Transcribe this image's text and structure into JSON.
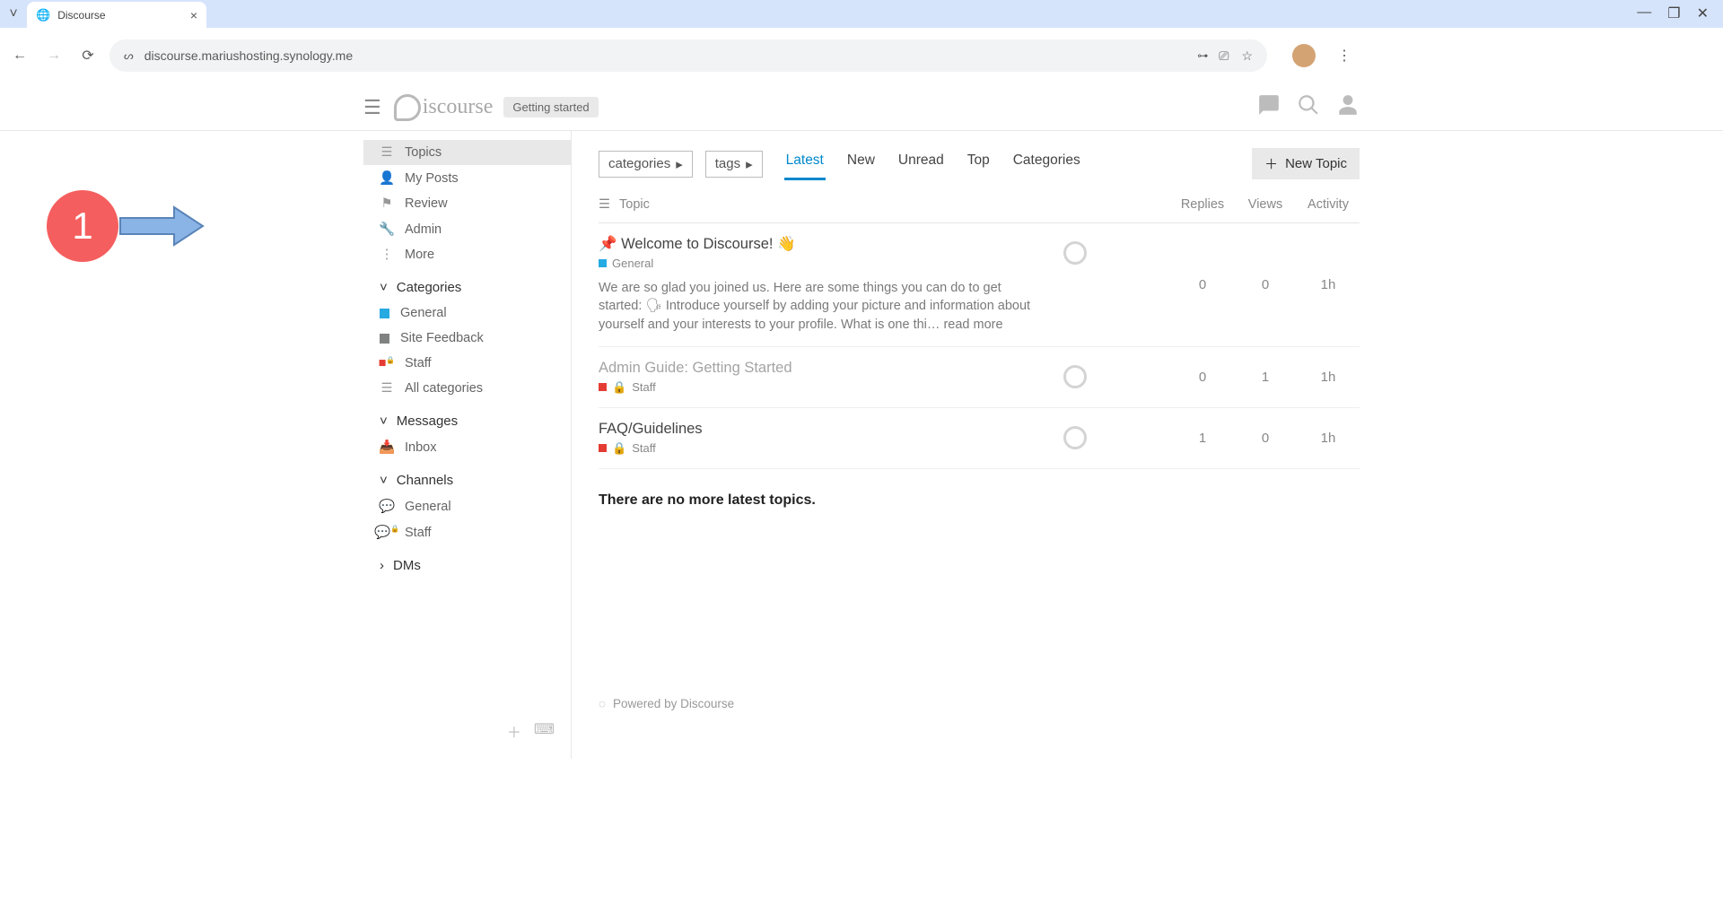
{
  "browser": {
    "tab_title": "Discourse",
    "url": "discourse.mariushosting.synology.me"
  },
  "header": {
    "logo_text": "iscourse",
    "getting_started": "Getting started"
  },
  "sidebar": {
    "topics": "Topics",
    "my_posts": "My Posts",
    "review": "Review",
    "admin": "Admin",
    "more": "More",
    "section_categories": "Categories",
    "cat_general": "General",
    "cat_site_feedback": "Site Feedback",
    "cat_staff": "Staff",
    "cat_all": "All categories",
    "section_messages": "Messages",
    "msg_inbox": "Inbox",
    "section_channels": "Channels",
    "ch_general": "General",
    "ch_staff": "Staff",
    "section_dms": "DMs"
  },
  "filters": {
    "categories": "categories",
    "tags": "tags"
  },
  "tabs": {
    "latest": "Latest",
    "new": "New",
    "unread": "Unread",
    "top": "Top",
    "categories": "Categories"
  },
  "buttons": {
    "new_topic": "New Topic"
  },
  "table": {
    "th_topic": "Topic",
    "th_replies": "Replies",
    "th_views": "Views",
    "th_activity": "Activity"
  },
  "topics": [
    {
      "title": "Welcome to Discourse! 👋",
      "pinned": true,
      "pin_glyph": "📌",
      "cat": "General",
      "cat_color": "#25aae2",
      "locked": false,
      "excerpt": "We are so glad you joined us. Here are some things you can do to get started: 🗣 Introduce yourself by adding your picture and information about yourself and your interests to your profile. What is one thi…",
      "read_more": "read more",
      "replies": "0",
      "views": "0",
      "activity": "1h"
    },
    {
      "title": "Admin Guide: Getting Started",
      "dim": true,
      "cat": "Staff",
      "cat_color": "#e43c33",
      "locked": true,
      "replies": "0",
      "views": "1",
      "activity": "1h"
    },
    {
      "title": "FAQ/Guidelines",
      "cat": "Staff",
      "cat_color": "#e43c33",
      "locked": true,
      "replies": "1",
      "views": "0",
      "activity": "1h"
    }
  ],
  "no_more": "There are no more latest topics.",
  "footer": "Powered by Discourse",
  "callout_number": "1"
}
